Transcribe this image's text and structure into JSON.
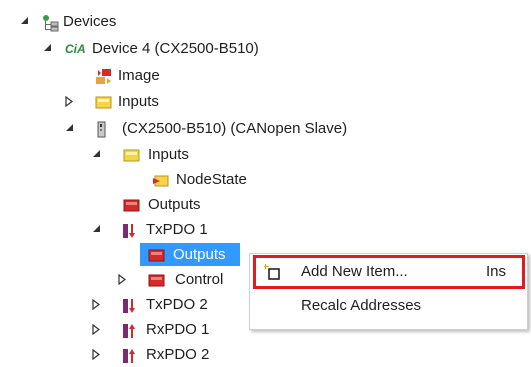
{
  "tree": {
    "devices": "Devices",
    "device4": "Device 4 (CX2500-B510)",
    "cia_badge": "CiA",
    "image": "Image",
    "inputs1": "Inputs",
    "cx_slave": "(CX2500-B510) (CANopen Slave)",
    "inputs2": "Inputs",
    "nodestate": "NodeState",
    "outputs1": "Outputs",
    "txpdo1": "TxPDO 1",
    "outputs_sel": "Outputs",
    "control": "Control",
    "txpdo2": "TxPDO 2",
    "rxpdo1": "RxPDO 1",
    "rxpdo2": "RxPDO 2"
  },
  "context_menu": {
    "add_new_item": "Add New Item...",
    "add_new_item_shortcut": "Ins",
    "recalc_addresses": "Recalc Addresses"
  },
  "colors": {
    "selection": "#3399ff",
    "highlight_border": "#e01b22",
    "folder_yellow": "#f5d34a",
    "var_red": "#d42a2a",
    "cia_green": "#2d8a3e"
  }
}
